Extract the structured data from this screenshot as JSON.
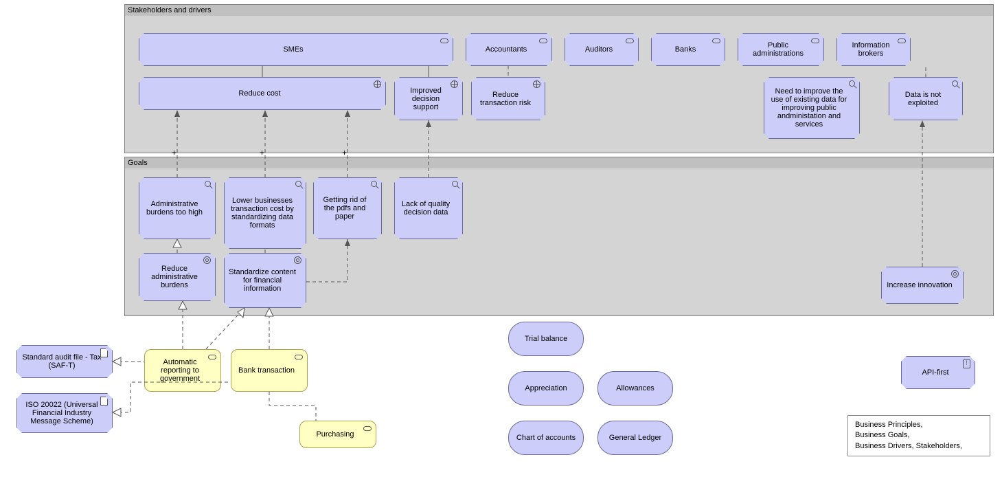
{
  "groups": {
    "stakeholders": "Stakeholders and drivers",
    "goals": "Goals"
  },
  "stakeholders": {
    "smes": "SMEs",
    "accountants": "Accountants",
    "auditors": "Auditors",
    "banks": "Banks",
    "public_admin": "Public administrations",
    "info_brokers": "Information brokers"
  },
  "drivers": {
    "reduce_cost": "Reduce cost",
    "improved_decision": "Improved decision support",
    "reduce_tx_risk": "Reduce transaction risk"
  },
  "assessments": {
    "need_improve": "Need to improve the use of existing data for improving public andministation and services",
    "data_not_exploited": "Data is not exploited",
    "admin_burdens": "Administrative burdens too high",
    "lower_tx_cost": "Lower businesses transaction cost by standardizing data formats",
    "rid_pdfs": "Getting rid of the pdfs and paper",
    "lack_quality": "Lack of quality decision data"
  },
  "goals_items": {
    "reduce_admin": "Reduce administrative burdens",
    "standardize": "Standardize content for financial information",
    "increase_innovation": "Increase innovation"
  },
  "courses": {
    "auto_report": "Automatic reporting to government",
    "bank_tx": "Bank transaction",
    "purchasing": "Purchasing"
  },
  "dataobjects": {
    "saf_t": "Standard audit file - Tax (SAF-T)",
    "iso20022": "ISO 20022 (Universal Financial Industry Message Scheme)"
  },
  "principle": {
    "api_first": "API-first"
  },
  "clouds": {
    "trial_balance": "Trial balance",
    "appreciation": "Appreciation",
    "allowances": "Allowances",
    "chart_of_accounts": "Chart of accounts",
    "general_ledger": "General Ledger"
  },
  "note": {
    "line1": "Business Principles,",
    "line2": "Business Goals,",
    "line3": "Business Drivers, Stakeholders,"
  }
}
